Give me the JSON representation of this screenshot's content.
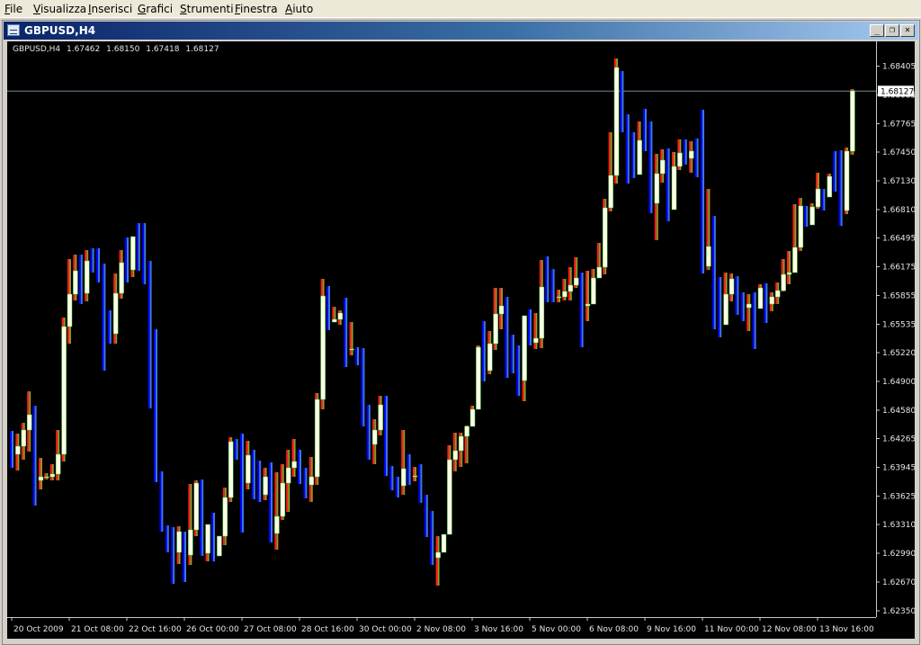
{
  "menubar": {
    "items": [
      {
        "label": "File",
        "accel": "F",
        "rest": "ile"
      },
      {
        "label": "Visualizza",
        "accel": "V",
        "rest": "isualizza"
      },
      {
        "label": "Inserisci",
        "accel": "I",
        "rest": "nserisci"
      },
      {
        "label": "Grafici",
        "accel": "G",
        "rest": "rafici"
      },
      {
        "label": "Strumenti",
        "accel": "S",
        "rest": "trumenti"
      },
      {
        "label": "Finestra",
        "accel": "F",
        "rest": "inestra"
      },
      {
        "label": "Aiuto",
        "accel": "A",
        "rest": "iuto"
      }
    ]
  },
  "window": {
    "title": "GBPUSD,H4",
    "buttons": {
      "minimize": "_",
      "restore": "❐",
      "close": "✕"
    }
  },
  "chart_header": {
    "symbol": "GBPUSD,H4",
    "open": "1.67462",
    "high": "1.68150",
    "low": "1.67418",
    "close": "1.68127"
  },
  "chart_data": {
    "type": "candlestick",
    "symbol": "GBPUSD",
    "timeframe": "H4",
    "ylim": [
      1.6228,
      1.6868
    ],
    "y_ticks": [
      "1.68405",
      "1.68085",
      "1.67765",
      "1.67450",
      "1.67130",
      "1.66810",
      "1.66495",
      "1.66175",
      "1.65855",
      "1.65535",
      "1.65220",
      "1.64900",
      "1.64580",
      "1.64265",
      "1.63945",
      "1.63625",
      "1.63310",
      "1.62990",
      "1.62670",
      "1.62350"
    ],
    "y_tick_values": [
      1.68405,
      1.68085,
      1.67765,
      1.6745,
      1.6713,
      1.6681,
      1.66495,
      1.66175,
      1.65855,
      1.65535,
      1.6522,
      1.649,
      1.6458,
      1.64265,
      1.63945,
      1.63625,
      1.6331,
      1.6299,
      1.6267,
      1.6235
    ],
    "current_price_label": "1.68127",
    "current_price": 1.68127,
    "x_labels": [
      "20 Oct 2009",
      "21 Oct 08:00",
      "22 Oct 16:00",
      "26 Oct 00:00",
      "27 Oct 08:00",
      "28 Oct 16:00",
      "30 Oct 00:00",
      "2 Nov 08:00",
      "3 Nov 16:00",
      "5 Nov 00:00",
      "6 Nov 08:00",
      "9 Nov 16:00",
      "11 Nov 00:00",
      "12 Nov 08:00",
      "13 Nov 16:00"
    ],
    "x_label_index": [
      0,
      10,
      20,
      30,
      40,
      50,
      60,
      70,
      80,
      90,
      100,
      110,
      120,
      130,
      140
    ],
    "bull_color": "#ffffe6",
    "bear_color": "#ffffe6",
    "bull_wick_color": "#46c846",
    "bar_colors_up": [
      "#ff1e1e",
      "#e65a00"
    ],
    "bar_colors_down": [
      "#0000ff",
      "#3c78dc"
    ],
    "candles": [
      [
        1.6418,
        1.6409,
        1.6394,
        1.6435
      ],
      [
        1.6409,
        1.6418,
        1.6391,
        1.6432
      ],
      [
        1.6418,
        1.6436,
        1.6403,
        1.6444
      ],
      [
        1.6436,
        1.6453,
        1.6412,
        1.6479
      ],
      [
        1.6453,
        1.638,
        1.6352,
        1.6463
      ],
      [
        1.638,
        1.6384,
        1.637,
        1.6405
      ],
      [
        1.6384,
        1.6384,
        1.6381,
        1.6388
      ],
      [
        1.6384,
        1.6387,
        1.638,
        1.6398
      ],
      [
        1.6387,
        1.6409,
        1.638,
        1.6436
      ],
      [
        1.6409,
        1.6551,
        1.6401,
        1.6561
      ],
      [
        1.6551,
        1.6587,
        1.6532,
        1.6626
      ],
      [
        1.6587,
        1.6613,
        1.658,
        1.6631
      ],
      [
        1.6613,
        1.6588,
        1.6576,
        1.6631
      ],
      [
        1.6588,
        1.6624,
        1.6579,
        1.6636
      ],
      [
        1.6624,
        1.6617,
        1.6611,
        1.6638
      ],
      [
        1.6617,
        1.661,
        1.66,
        1.6638
      ],
      [
        1.661,
        1.6545,
        1.6502,
        1.6621
      ],
      [
        1.6545,
        1.6543,
        1.6532,
        1.6569
      ],
      [
        1.6543,
        1.6588,
        1.6532,
        1.661
      ],
      [
        1.6588,
        1.6622,
        1.6582,
        1.6636
      ],
      [
        1.6622,
        1.6614,
        1.66,
        1.665
      ],
      [
        1.6614,
        1.6651,
        1.6606,
        1.6651
      ],
      [
        1.6651,
        1.6627,
        1.6613,
        1.6666
      ],
      [
        1.6627,
        1.6619,
        1.6598,
        1.6666
      ],
      [
        1.6619,
        1.6523,
        1.646,
        1.6624
      ],
      [
        1.6523,
        1.639,
        1.6378,
        1.6548
      ],
      [
        1.639,
        1.6329,
        1.6323,
        1.639
      ],
      [
        1.6329,
        1.6304,
        1.63,
        1.633
      ],
      [
        1.6304,
        1.63,
        1.6265,
        1.6328
      ],
      [
        1.63,
        1.6323,
        1.6287,
        1.6329
      ],
      [
        1.6323,
        1.6297,
        1.6267,
        1.6323
      ],
      [
        1.6297,
        1.6325,
        1.6286,
        1.6376
      ],
      [
        1.6325,
        1.6377,
        1.6318,
        1.638
      ],
      [
        1.6377,
        1.6299,
        1.6296,
        1.6381
      ],
      [
        1.6299,
        1.6331,
        1.629,
        1.6331
      ],
      [
        1.6331,
        1.6296,
        1.629,
        1.6344
      ],
      [
        1.6296,
        1.6318,
        1.6303,
        1.6315
      ],
      [
        1.6318,
        1.6361,
        1.6308,
        1.6372
      ],
      [
        1.6361,
        1.6423,
        1.6356,
        1.6428
      ],
      [
        1.6423,
        1.6411,
        1.6403,
        1.6426
      ],
      [
        1.6411,
        1.6377,
        1.6322,
        1.6432
      ],
      [
        1.6377,
        1.6408,
        1.637,
        1.6424
      ],
      [
        1.6408,
        1.6382,
        1.6359,
        1.6414
      ],
      [
        1.6382,
        1.6364,
        1.6356,
        1.6402
      ],
      [
        1.6364,
        1.6384,
        1.6358,
        1.6394
      ],
      [
        1.6384,
        1.6321,
        1.6311,
        1.64
      ],
      [
        1.6321,
        1.634,
        1.6303,
        1.6389
      ],
      [
        1.634,
        1.6377,
        1.6336,
        1.6398
      ],
      [
        1.6377,
        1.6394,
        1.6345,
        1.6414
      ],
      [
        1.6394,
        1.6401,
        1.6384,
        1.6426
      ],
      [
        1.6401,
        1.6392,
        1.6376,
        1.6414
      ],
      [
        1.6392,
        1.6375,
        1.636,
        1.6394
      ],
      [
        1.6375,
        1.6384,
        1.6356,
        1.6406
      ],
      [
        1.6384,
        1.647,
        1.6375,
        1.6477
      ],
      [
        1.647,
        1.6585,
        1.6459,
        1.6604
      ],
      [
        1.6585,
        1.6556,
        1.6547,
        1.6596
      ],
      [
        1.6556,
        1.6559,
        1.6557,
        1.6573
      ],
      [
        1.6559,
        1.6566,
        1.6553,
        1.6569
      ],
      [
        1.6566,
        1.6526,
        1.6506,
        1.6583
      ],
      [
        1.6526,
        1.6526,
        1.6519,
        1.6556
      ],
      [
        1.6526,
        1.6515,
        1.6508,
        1.6528
      ],
      [
        1.6515,
        1.644,
        1.644,
        1.6527
      ],
      [
        1.644,
        1.642,
        1.6403,
        1.6464
      ],
      [
        1.642,
        1.6436,
        1.6398,
        1.6448
      ],
      [
        1.6436,
        1.6464,
        1.643,
        1.6474
      ],
      [
        1.6464,
        1.639,
        1.6385,
        1.6474
      ],
      [
        1.639,
        1.6382,
        1.6369,
        1.6396
      ],
      [
        1.6382,
        1.6374,
        1.6361,
        1.6384
      ],
      [
        1.6374,
        1.6393,
        1.6364,
        1.6436
      ],
      [
        1.6393,
        1.6385,
        1.6375,
        1.6409
      ],
      [
        1.6385,
        1.6385,
        1.6379,
        1.6395
      ],
      [
        1.6385,
        1.6364,
        1.6355,
        1.6398
      ],
      [
        1.6364,
        1.6331,
        1.6317,
        1.6364
      ],
      [
        1.6331,
        1.6294,
        1.6286,
        1.6346
      ],
      [
        1.6294,
        1.63,
        1.6263,
        1.6318
      ],
      [
        1.63,
        1.632,
        1.63,
        1.632
      ],
      [
        1.632,
        1.6403,
        1.632,
        1.6419
      ],
      [
        1.6403,
        1.6413,
        1.639,
        1.6433
      ],
      [
        1.6413,
        1.6429,
        1.6395,
        1.6433
      ],
      [
        1.6429,
        1.644,
        1.6399,
        1.6441
      ],
      [
        1.644,
        1.6459,
        1.6446,
        1.6463
      ],
      [
        1.6459,
        1.6528,
        1.6459,
        1.653
      ],
      [
        1.6528,
        1.6502,
        1.649,
        1.6557
      ],
      [
        1.6502,
        1.6532,
        1.6498,
        1.6546
      ],
      [
        1.6532,
        1.6565,
        1.6525,
        1.6594
      ],
      [
        1.6565,
        1.6574,
        1.6548,
        1.6594
      ],
      [
        1.6574,
        1.6522,
        1.6494,
        1.6584
      ],
      [
        1.6522,
        1.6508,
        1.6499,
        1.6542
      ],
      [
        1.6508,
        1.6491,
        1.6474,
        1.653
      ],
      [
        1.6491,
        1.6563,
        1.6468,
        1.6563
      ],
      [
        1.6563,
        1.6533,
        1.653,
        1.657
      ],
      [
        1.6533,
        1.6538,
        1.6526,
        1.6566
      ],
      [
        1.6538,
        1.6595,
        1.6527,
        1.6625
      ],
      [
        1.6595,
        1.6592,
        1.6578,
        1.6629
      ],
      [
        1.6592,
        1.6584,
        1.6578,
        1.6615
      ],
      [
        1.6584,
        1.6584,
        1.6578,
        1.6592
      ],
      [
        1.6584,
        1.659,
        1.658,
        1.6604
      ],
      [
        1.659,
        1.6597,
        1.658,
        1.6617
      ],
      [
        1.6597,
        1.6605,
        1.6594,
        1.6628
      ],
      [
        1.6605,
        1.6574,
        1.6528,
        1.6611
      ],
      [
        1.6574,
        1.6576,
        1.6557,
        1.6613
      ],
      [
        1.6576,
        1.6605,
        1.6583,
        1.6615
      ],
      [
        1.6605,
        1.6617,
        1.6614,
        1.6644
      ],
      [
        1.6617,
        1.6683,
        1.6609,
        1.6693
      ],
      [
        1.6683,
        1.6719,
        1.6679,
        1.6767
      ],
      [
        1.6719,
        1.6839,
        1.671,
        1.6849
      ],
      [
        1.6839,
        1.6781,
        1.6767,
        1.6835
      ],
      [
        1.6781,
        1.6761,
        1.671,
        1.6787
      ],
      [
        1.6761,
        1.672,
        1.6716,
        1.6767
      ],
      [
        1.672,
        1.6758,
        1.673,
        1.6779
      ],
      [
        1.6758,
        1.6752,
        1.6746,
        1.6793
      ],
      [
        1.6752,
        1.6688,
        1.6677,
        1.6779
      ],
      [
        1.6688,
        1.6721,
        1.6647,
        1.6743
      ],
      [
        1.6721,
        1.6736,
        1.6711,
        1.6748
      ],
      [
        1.6736,
        1.6681,
        1.6668,
        1.6749
      ],
      [
        1.6681,
        1.6729,
        1.6686,
        1.6745
      ],
      [
        1.6729,
        1.6744,
        1.6725,
        1.6759
      ],
      [
        1.6744,
        1.6738,
        1.6731,
        1.6759
      ],
      [
        1.6738,
        1.6746,
        1.6722,
        1.6757
      ],
      [
        1.6746,
        1.6725,
        1.6717,
        1.676
      ],
      [
        1.6725,
        1.6618,
        1.661,
        1.6792
      ],
      [
        1.6618,
        1.664,
        1.6614,
        1.6704
      ],
      [
        1.664,
        1.6562,
        1.6548,
        1.6674
      ],
      [
        1.6562,
        1.6553,
        1.6539,
        1.6606
      ],
      [
        1.6553,
        1.6587,
        1.6565,
        1.6611
      ],
      [
        1.6587,
        1.6604,
        1.6579,
        1.661
      ],
      [
        1.6604,
        1.6596,
        1.6564,
        1.6607
      ],
      [
        1.6596,
        1.6572,
        1.6557,
        1.6589
      ],
      [
        1.6572,
        1.6576,
        1.6546,
        1.6587
      ],
      [
        1.6576,
        1.6571,
        1.6526,
        1.6589
      ],
      [
        1.6571,
        1.6594,
        1.6572,
        1.6598
      ],
      [
        1.6594,
        1.6576,
        1.6555,
        1.6599
      ],
      [
        1.6576,
        1.6584,
        1.6568,
        1.6589
      ],
      [
        1.6584,
        1.6591,
        1.6576,
        1.66
      ],
      [
        1.6591,
        1.6609,
        1.659,
        1.6626
      ],
      [
        1.6609,
        1.6611,
        1.6598,
        1.6635
      ],
      [
        1.6611,
        1.6639,
        1.6611,
        1.6687
      ],
      [
        1.6639,
        1.6685,
        1.6635,
        1.6694
      ],
      [
        1.6685,
        1.6664,
        1.6662,
        1.6685
      ],
      [
        1.6664,
        1.6684,
        1.6673,
        1.6688
      ],
      [
        1.6684,
        1.6704,
        1.6682,
        1.6722
      ],
      [
        1.6704,
        1.6695,
        1.668,
        1.6704
      ],
      [
        1.6695,
        1.6718,
        1.67,
        1.6721
      ],
      [
        1.6718,
        1.67,
        1.6701,
        1.6746
      ],
      [
        1.67,
        1.668,
        1.6663,
        1.6747
      ],
      [
        1.668,
        1.6746,
        1.6676,
        1.675
      ],
      [
        1.6746,
        1.6813,
        1.6742,
        1.6815
      ]
    ]
  }
}
